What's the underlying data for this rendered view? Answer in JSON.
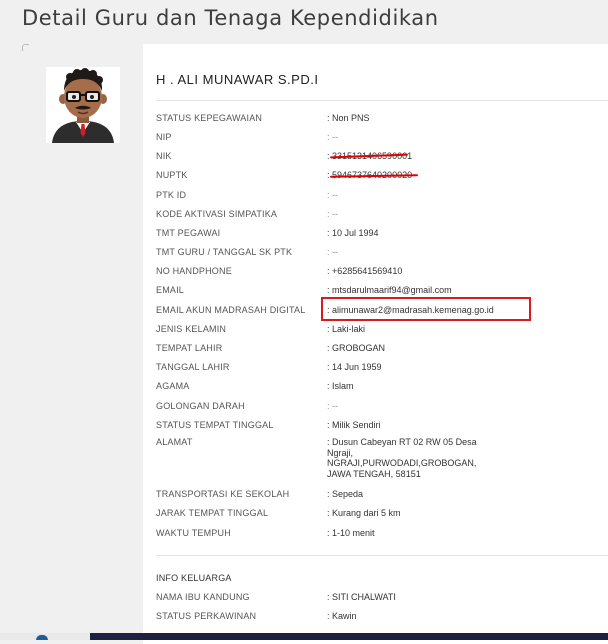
{
  "page_title": "Detail Guru dan Tenaga Kependidikan",
  "profile": {
    "name": "H . ALI MUNAWAR S.PD.I"
  },
  "fields": [
    {
      "label": "STATUS KEPEGAWAIAN",
      "value": ": Non PNS"
    },
    {
      "label": "NIP",
      "value": ": --"
    },
    {
      "label": "NIK",
      "value": ": 3315131406590001"
    },
    {
      "label": "NUPTK",
      "value": ": 5946737640200020"
    },
    {
      "label": "PTK ID",
      "value": ": --"
    },
    {
      "label": "KODE AKTIVASI SIMPATIKA",
      "value": ": --"
    },
    {
      "label": "TMT PEGAWAI",
      "value": ": 10 Jul 1994"
    },
    {
      "label": "TMT GURU / TANGGAL SK PTK",
      "value": ": --"
    },
    {
      "label": "NO HANDPHONE",
      "value": ": +6285641569410"
    },
    {
      "label": "EMAIL",
      "value": ": mtsdarulmaarif94@gmail.com"
    },
    {
      "label": "EMAIL AKUN MADRASAH DIGITAL",
      "value": ": alimunawar2@madrasah.kemenag.go.id"
    },
    {
      "label": "JENIS KELAMIN",
      "value": ": Laki-laki"
    },
    {
      "label": "TEMPAT LAHIR",
      "value": ": GROBOGAN"
    },
    {
      "label": "TANGGAL LAHIR",
      "value": ": 14 Jun 1959"
    },
    {
      "label": "AGAMA",
      "value": ": Islam"
    },
    {
      "label": "GOLONGAN DARAH",
      "value": ": --"
    },
    {
      "label": "STATUS TEMPAT TINGGAL",
      "value": ": Milik Sendiri"
    },
    {
      "label": "ALAMAT",
      "value": ": Dusun Cabeyan RT 02 RW 05 Desa\n  Ngraji,\n  NGRAJI,PURWODADI,GROBOGAN,\n  JAWA TENGAH, 58151"
    },
    {
      "label": "TRANSPORTASI KE SEKOLAH",
      "value": ": Sepeda"
    },
    {
      "label": "JARAK TEMPAT TINGGAL",
      "value": ": Kurang dari 5 km"
    },
    {
      "label": "WAKTU TEMPUH",
      "value": ": 1-10 menit"
    }
  ],
  "family_section": {
    "title": "INFO KELUARGA",
    "fields": [
      {
        "label": "NAMA IBU KANDUNG",
        "value": ": SITI CHALWATI"
      },
      {
        "label": "STATUS PERKAWINAN",
        "value": ": Kawin"
      }
    ]
  },
  "colors": {
    "annotation_red": "#d81b1b",
    "taskbar": "#1d2040"
  }
}
